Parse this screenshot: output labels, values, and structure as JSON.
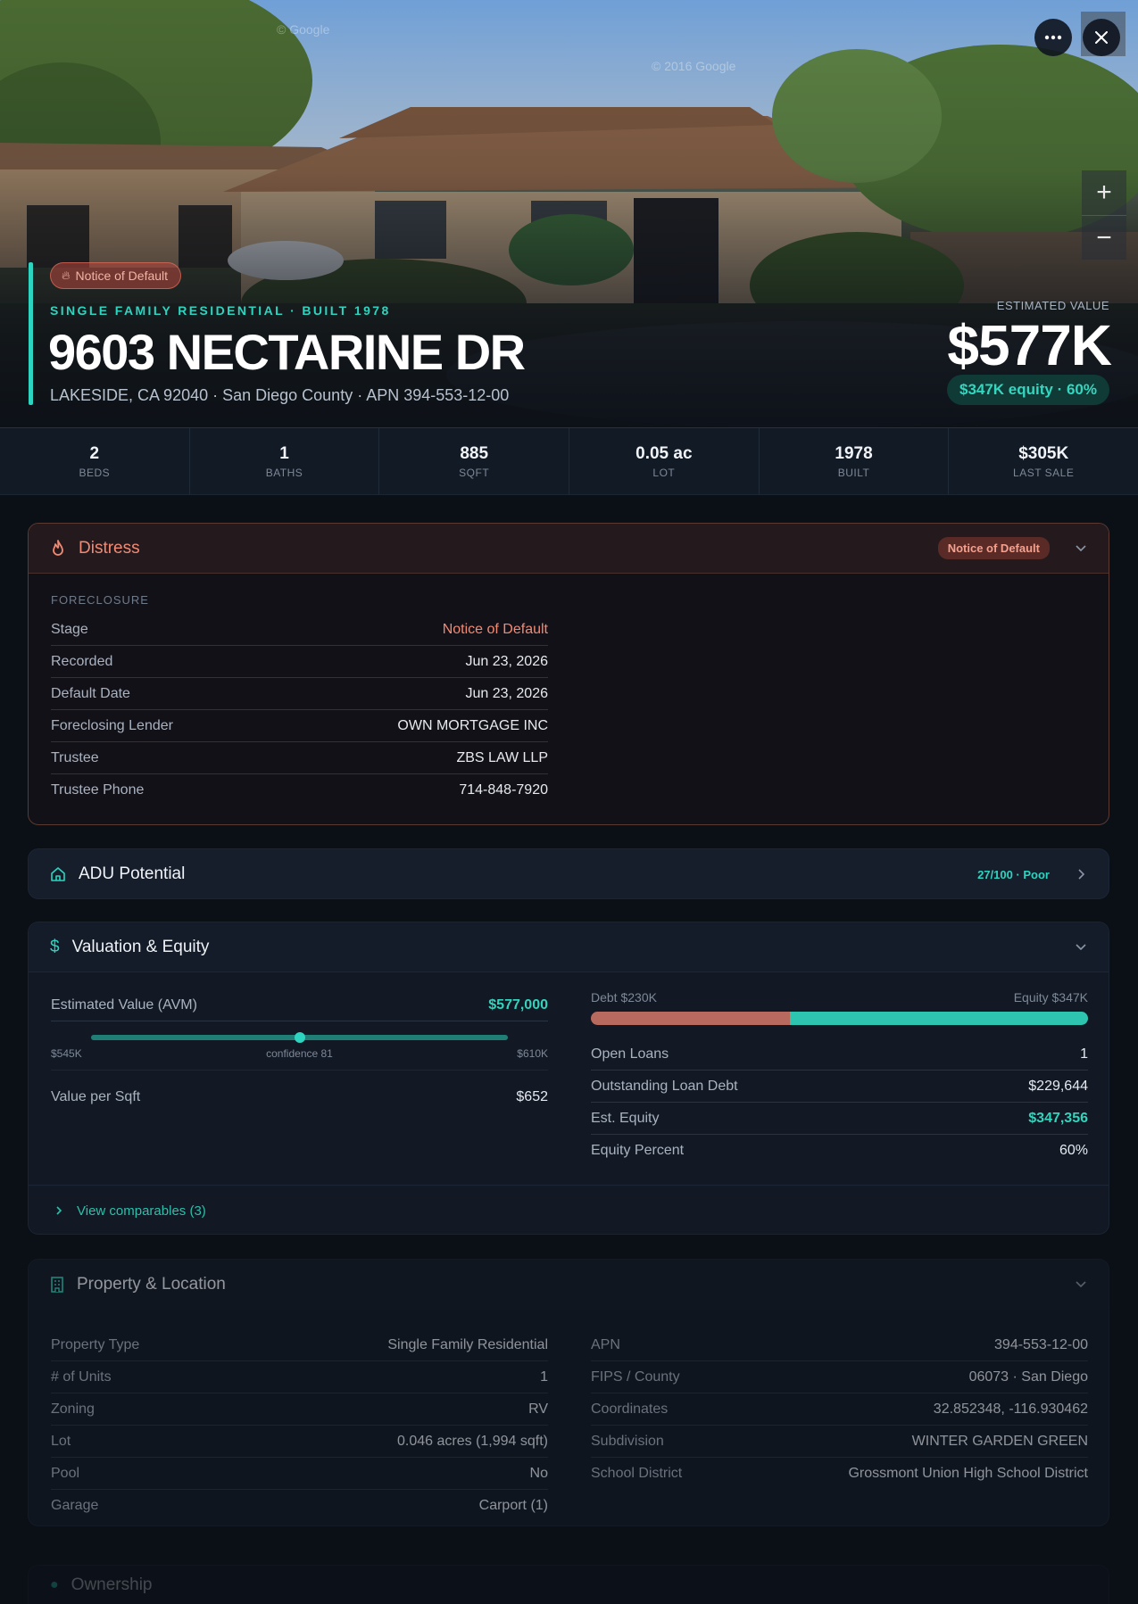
{
  "hero": {
    "watermark_1": "© Google",
    "watermark_2": "© 2016 Google",
    "distress_pill": "Notice of Default",
    "eyebrow": "SINGLE FAMILY RESIDENTIAL · BUILT 1978",
    "address": "9603 NECTARINE DR",
    "subaddress": "LAKESIDE, CA 92040 · San Diego County · APN 394-553-12-00",
    "estimated_label": "ESTIMATED VALUE",
    "estimated_value": "$577K",
    "equity_pill": "$347K equity · 60%",
    "zoom_in": "+",
    "zoom_out": "−"
  },
  "stats": [
    {
      "value": "2",
      "label": "BEDS"
    },
    {
      "value": "1",
      "label": "BATHS"
    },
    {
      "value": "885",
      "label": "SQFT"
    },
    {
      "value": "0.05 ac",
      "label": "LOT"
    },
    {
      "value": "1978",
      "label": "BUILT"
    },
    {
      "value": "$305K",
      "label": "LAST SALE"
    }
  ],
  "distress": {
    "title": "Distress",
    "badge": "Notice of Default",
    "section_label": "FORECLOSURE",
    "rows": [
      {
        "k": "Stage",
        "v": "Notice of Default"
      },
      {
        "k": "Recorded",
        "v": "Jun 23, 2026"
      },
      {
        "k": "Default Date",
        "v": "Jun 23, 2026"
      },
      {
        "k": "Foreclosing Lender",
        "v": "OWN MORTGAGE INC"
      },
      {
        "k": "Trustee",
        "v": "ZBS LAW LLP"
      },
      {
        "k": "Trustee Phone",
        "v": "714-848-7920"
      }
    ]
  },
  "adu": {
    "title": "ADU Potential",
    "score": "27/100 · Poor"
  },
  "valuation": {
    "title": "Valuation & Equity",
    "avm_label": "Estimated Value (AVM)",
    "avm_value": "$577,000",
    "range_low": "$545K",
    "range_mid": "confidence 81",
    "range_high": "$610K",
    "range_position": 0.5,
    "sqft_label": "Value per Sqft",
    "sqft_value": "$652",
    "debt_label": "Debt $230K",
    "equity_label": "Equity $347K",
    "debt_fraction": 0.4,
    "rows": [
      {
        "k": "Open Loans",
        "v": "1"
      },
      {
        "k": "Outstanding Loan Debt",
        "v": "$229,644"
      },
      {
        "k": "Est. Equity",
        "v": "$347,356"
      },
      {
        "k": "Equity Percent",
        "v": "60%"
      }
    ],
    "comps_link": "View comparables (3)"
  },
  "property": {
    "title": "Property & Location",
    "left_rows": [
      {
        "k": "Property Type",
        "v": "Single Family Residential"
      },
      {
        "k": "# of Units",
        "v": "1"
      },
      {
        "k": "Zoning",
        "v": "RV"
      },
      {
        "k": "Lot",
        "v": "0.046 acres (1,994 sqft)"
      },
      {
        "k": "Pool",
        "v": "No"
      },
      {
        "k": "Garage",
        "v": "Carport (1)"
      }
    ],
    "right_rows": [
      {
        "k": "APN",
        "v": "394-553-12-00"
      },
      {
        "k": "FIPS / County",
        "v": "06073 · San Diego"
      },
      {
        "k": "Coordinates",
        "v": "32.852348, -116.930462"
      },
      {
        "k": "Subdivision",
        "v": "WINTER GARDEN GREEN"
      },
      {
        "k": "School District",
        "v": "Grossmont Union High School District"
      }
    ]
  },
  "ownership": {
    "title": "Ownership"
  },
  "colors": {
    "accent": "#2dd4bf",
    "distress": "#f28a73",
    "debt": "#b86a5f",
    "equity": "#2dc4b0"
  }
}
